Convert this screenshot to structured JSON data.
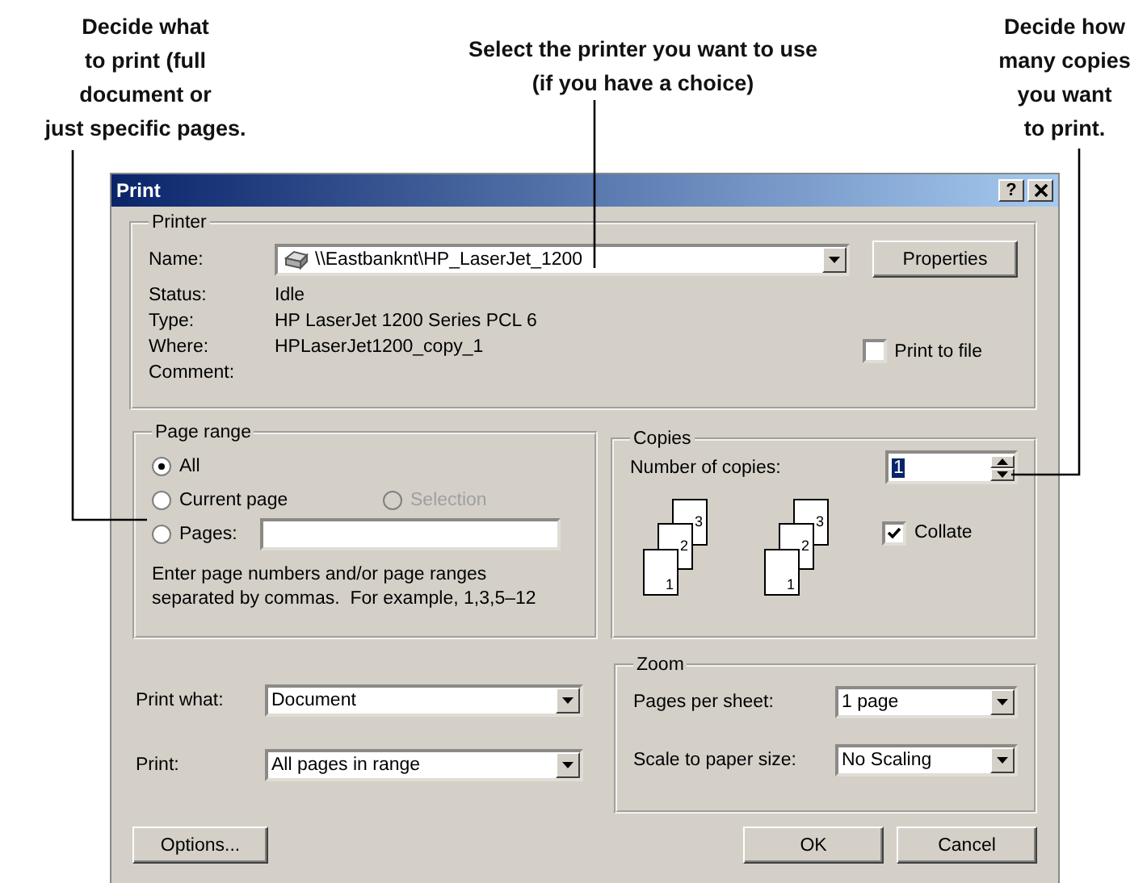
{
  "annotations": [
    {
      "lines": [
        "Decide what",
        "to print (full",
        "document or",
        "just specific pages."
      ]
    },
    {
      "lines": [
        "Select the printer you want to use",
        "(if you have a choice)"
      ]
    },
    {
      "lines": [
        "Decide how",
        "many copies",
        "you want",
        "to print."
      ]
    }
  ],
  "dialog": {
    "title": "Print",
    "help_button": "?",
    "printer": {
      "label": "Printer",
      "name_label": "Name:",
      "name_value": "\\\\Eastbanknt\\HP_LaserJet_1200",
      "properties_button": "Properties",
      "info": [
        {
          "label": "Status:",
          "value": "Idle"
        },
        {
          "label": "Type:",
          "value": "HP LaserJet 1200 Series PCL 6"
        },
        {
          "label": "Where:",
          "value": "HPLaserJet1200_copy_1"
        },
        {
          "label": "Comment:"
        }
      ],
      "print_to_file": {
        "label": "Print to file",
        "checked": false
      }
    },
    "page_range": {
      "label": "Page range",
      "options": [
        {
          "label": "All",
          "selected": true,
          "disabled": false
        },
        {
          "label": "Current page",
          "selected": false,
          "disabled": false
        },
        {
          "label": "Selection",
          "selected": false,
          "disabled": true
        },
        {
          "label": "Pages:",
          "selected": false,
          "disabled": false
        }
      ],
      "hint": "Enter page numbers and/or page ranges separated by commas.  For example, 1,3,5–12"
    },
    "copies": {
      "label": "Copies",
      "number_label": "Number of copies:",
      "number_value": "1",
      "value_highlighted": true,
      "stacks": [
        {
          "pages": [
            "3",
            "2",
            "1"
          ]
        },
        {
          "pages": [
            "3",
            "2",
            "1"
          ]
        }
      ],
      "collate": {
        "label": "Collate",
        "checked": true
      }
    },
    "print_what": {
      "label": "Print what:",
      "value": "Document"
    },
    "print": {
      "label": "Print:",
      "value": "All pages in range"
    },
    "zoom": {
      "label": "Zoom",
      "pages_per_sheet": {
        "label": "Pages per sheet:",
        "value": "1 page"
      },
      "scale": {
        "label": "Scale to paper size:",
        "value": "No Scaling"
      }
    },
    "buttons": {
      "options": "Options...",
      "ok": "OK",
      "cancel": "Cancel"
    }
  }
}
